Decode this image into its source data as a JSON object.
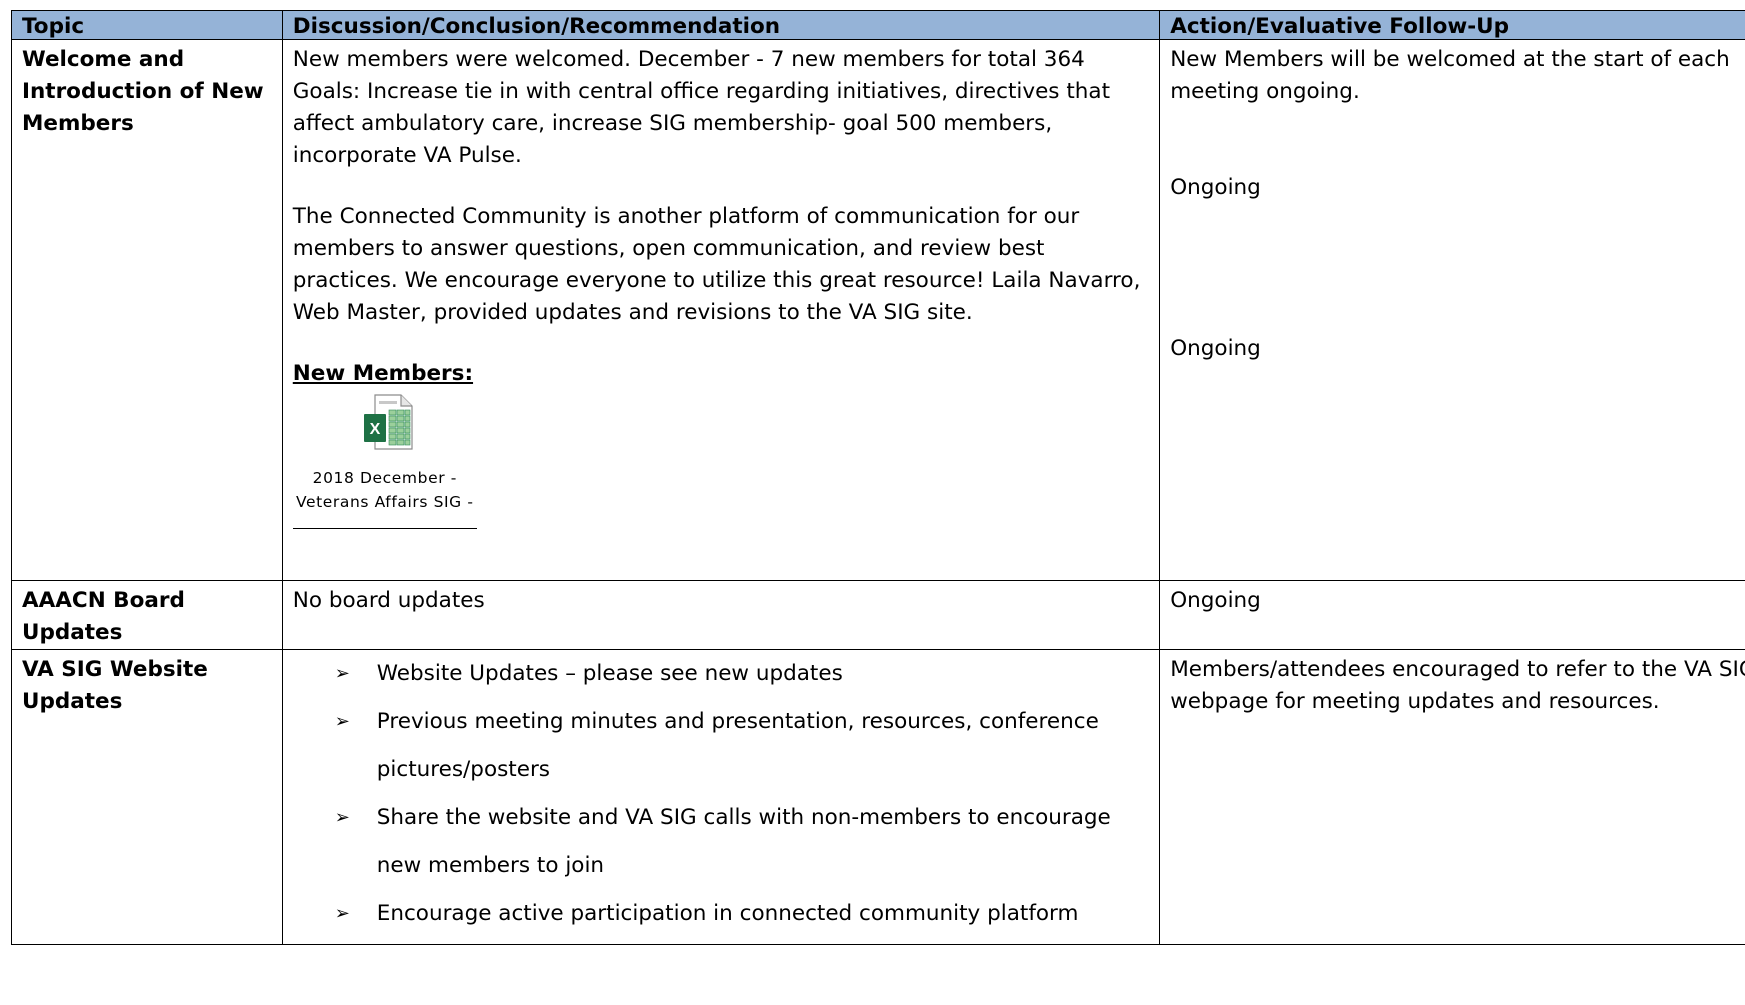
{
  "table": {
    "headers": [
      "Topic",
      "Discussion/Conclusion/Recommendation",
      "Action/Evaluative Follow-Up"
    ],
    "rows": [
      {
        "topic": "Welcome and Introduction of New Members",
        "discussion": {
          "p1": "New members were welcomed. December - 7 new members for total 364 Goals: Increase tie in with central office regarding initiatives, directives that affect ambulatory care, increase SIG membership- goal 500 members, incorporate VA Pulse.",
          "p2": "The Connected Community is another platform of communication for our members to answer questions, open communication, and review best practices. We encourage everyone to utilize this great resource!  Laila Navarro, Web Master, provided updates and revisions to the VA SIG site.",
          "new_members_label": "New Members:",
          "attachment": {
            "icon": "excel-file-icon",
            "caption_line1": "2018 December -",
            "caption_line2": "Veterans Affairs SIG -"
          }
        },
        "actions": [
          "New Members will be welcomed at the start of each meeting ongoing.",
          "Ongoing",
          "Ongoing"
        ]
      },
      {
        "topic": "AAACN Board Updates",
        "discussion": "No board updates",
        "action": "Ongoing"
      },
      {
        "topic": "VA SIG Website Updates",
        "bullets": [
          "Website Updates – please see new updates",
          "Previous meeting minutes and presentation, resources, conference pictures/posters",
          "Share the website and VA SIG calls with non-members to encourage new members to join",
          "Encourage active participation in connected community platform"
        ],
        "action": "Members/attendees encouraged to refer to the VA SIG webpage for meeting updates and resources."
      }
    ]
  },
  "colors": {
    "header_bg": "#95b3d7",
    "excel_green": "#1e7145"
  }
}
